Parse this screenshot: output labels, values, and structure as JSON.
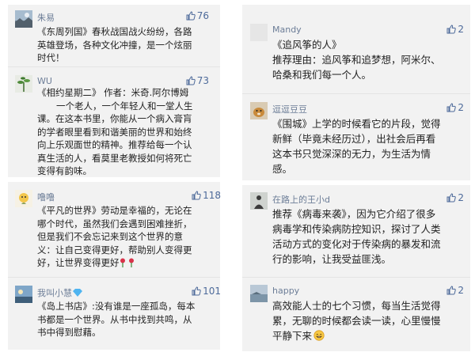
{
  "comments": [
    {
      "username": "朱易",
      "likes": "76",
      "avatar_icon": "landscape-avatar",
      "lines": [
        "《东周列国》春秋战国战火纷纷，各路",
        "英雄登场，各种文化冲撞，是一个炫丽",
        "时代！"
      ]
    },
    {
      "username": "WU",
      "likes": "73",
      "avatar_icon": "plant-avatar",
      "lines": [
        "《相约星期二》 作者：米奇.阿尔博姆",
        "一个老人，一个年轻人和一堂人生",
        "课。在这本书里，你能从一个病入膏肓",
        "的学者眼里看到和谐美丽的世界和始终",
        "向上乐观面世的精神。推荐给每一个认",
        "真生活的人，看莫里老教授如何将死亡",
        "变得有韵味。"
      ]
    },
    {
      "username": "噜噜",
      "likes": "118",
      "avatar_icon": "cartoon-avatar",
      "lines": [
        "《平凡的世界》劳动是幸福的，无论在",
        "哪个时代，虽然我们会遇到困难挫折，",
        "但是我们不会忘记来到这个世界的意",
        "义：让自己变得更好，帮助别人变得更",
        "好，让世界变得更好"
      ],
      "trailing_emoji": "rose-emoji"
    },
    {
      "username": "我叫小慧",
      "username_badge": "diamond-badge",
      "likes": "101",
      "avatar_icon": "sky-avatar",
      "lines": [
        "《岛上书店》:没有谁是一座孤岛，每本",
        "书都是一个世界。从书中找到共鸣，从",
        "书中得到慰藉。"
      ]
    },
    {
      "username": "Mandy",
      "likes": "2",
      "avatar_icon": "empty-avatar",
      "lines": [
        "《追风筝的人》",
        "推荐理由：追风筝和追梦想，阿米尔、",
        "哈桑和我们每一个人。"
      ]
    },
    {
      "username": "逗逗豆豆",
      "likes": "2",
      "avatar_icon": "dog-avatar",
      "lines": [
        "《围城》上学的时候看它的片段，觉得",
        "新鲜（毕竟未经历过），出社会后再看",
        "这本书只觉深深的无力，为生活为情",
        "感。"
      ]
    },
    {
      "username": "在路上的王小d",
      "likes": "2",
      "avatar_icon": "silhouette-avatar",
      "lines": [
        "推荐《病毒来袭》，因为它介绍了很多",
        "病毒学和传染病防控知识，探讨了人类",
        "活动方式的变化对于传染病的暴发和流",
        "行的影响，让我受益匪浅。"
      ]
    },
    {
      "username": "happy",
      "likes": "2",
      "avatar_icon": "seascape-avatar",
      "lines": [
        "高效能人士的七个习惯，每当生活觉得",
        "累，无聊的时候都会读一读，心里慢慢",
        "平静下来"
      ],
      "trailing_emoji": "smile-emoji"
    }
  ],
  "colors": {
    "panel_bg": "#f2f2f2",
    "username": "#6c7d97",
    "likes": "#4d6a9a",
    "text": "#222222"
  }
}
